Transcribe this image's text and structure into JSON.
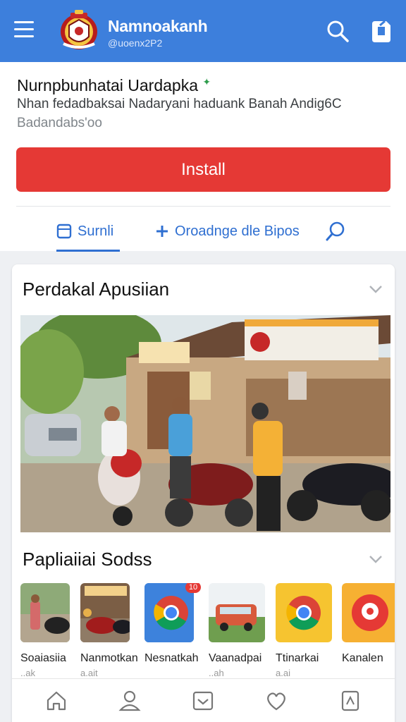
{
  "app": {
    "name": "Namnoakanh",
    "handle": "@uoenx2P2"
  },
  "header": {
    "title": "Nurnpbunhatai Uardapka",
    "subtitle": "Nhan fedadbaksai Nadaryani haduank Banah Andig6C",
    "subtitle2": "Badandabs'oo",
    "install_label": "Install"
  },
  "tabs": [
    {
      "label": "Surnli",
      "active": true
    },
    {
      "label": "Oroadnge dle Bipos",
      "active": false
    }
  ],
  "sections": {
    "featured_title": "Perdakal Apusiian",
    "popular_title": "Papliaiiai Sodss"
  },
  "thumbnails": [
    {
      "label": "Soaiasiia",
      "sub": "..ak",
      "icon": "photo-street"
    },
    {
      "label": "Nanmotkan",
      "sub": "a.ait",
      "icon": "photo-motorbike"
    },
    {
      "label": "Nesnatkah",
      "sub": "",
      "icon": "chrome-icon",
      "badge": "10"
    },
    {
      "label": "Vaanadpai",
      "sub": "..ah",
      "icon": "photo-van"
    },
    {
      "label": "Ttinarkai",
      "sub": "a.ai",
      "icon": "chrome-icon-yellow"
    },
    {
      "label": "Kanalen",
      "sub": "",
      "icon": "red-app-icon"
    }
  ],
  "bottom_nav": [
    "home-icon",
    "profile-icon",
    "inbox-icon",
    "heart-icon",
    "bookmark-icon"
  ],
  "colors": {
    "brand": "#3d7fdc",
    "install": "#e53935",
    "accent": "#2f6fd1"
  }
}
